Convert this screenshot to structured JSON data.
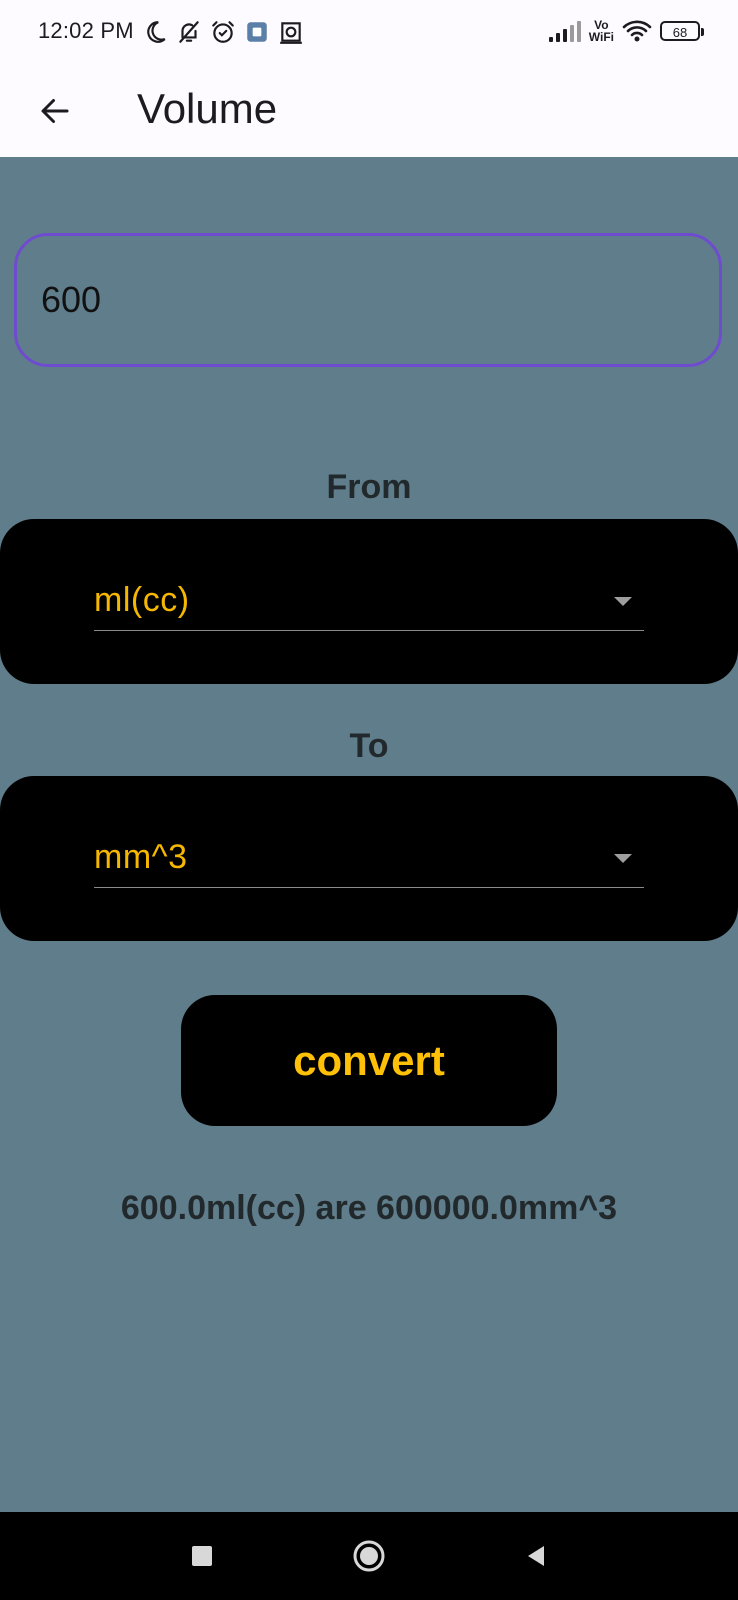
{
  "status_bar": {
    "time": "12:02 PM",
    "network_label_top": "Vo",
    "network_label_bottom": "WiFi",
    "battery": "68",
    "icons": [
      "moon-icon",
      "bell-off-icon",
      "alarm-icon",
      "gallery-icon",
      "screenshot-icon",
      "signal-icon",
      "wifi-icon",
      "battery-icon"
    ]
  },
  "app_bar": {
    "title": "Volume",
    "back_icon": "arrow-left-icon"
  },
  "amount_input": {
    "value": "600"
  },
  "from": {
    "label": "From",
    "selected": "ml(cc)"
  },
  "to": {
    "label": "To",
    "selected": "mm^3"
  },
  "convert_button": {
    "label": "convert"
  },
  "result": {
    "text": "600.0ml(cc) are 600000.0mm^3"
  },
  "colors": {
    "background": "#607d8b",
    "accent": "#ffc107",
    "dropdown_text": "#f5b700",
    "input_border": "#6f4ccf",
    "card": "#000000"
  }
}
